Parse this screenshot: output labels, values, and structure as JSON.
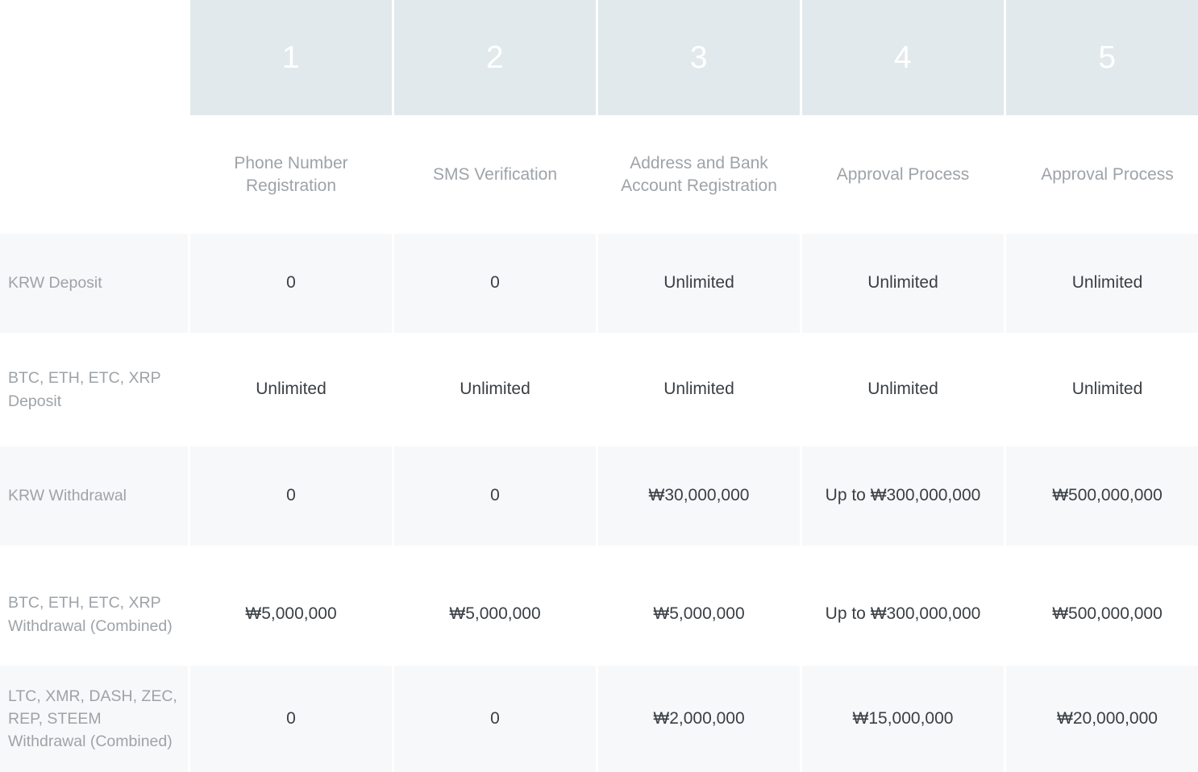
{
  "table": {
    "step_numbers": [
      "1",
      "2",
      "3",
      "4",
      "5"
    ],
    "step_names": [
      "Phone Number Registration",
      "SMS Verification",
      "Address and Bank Account Registration",
      "Approval Process",
      "Approval Process"
    ],
    "corner_label": "",
    "rows": [
      {
        "label": "KRW Deposit",
        "values": [
          "0",
          "0",
          "Unlimited",
          "Unlimited",
          "Unlimited"
        ]
      },
      {
        "label": "BTC, ETH, ETC, XRP Deposit",
        "values": [
          "Unlimited",
          "Unlimited",
          "Unlimited",
          "Unlimited",
          "Unlimited"
        ]
      },
      {
        "label": "KRW Withdrawal",
        "values": [
          "0",
          "0",
          "₩30,000,000",
          "Up to ₩300,000,000",
          "₩500,000,000"
        ]
      },
      {
        "label": "BTC, ETH, ETC, XRP Withdrawal (Combined)",
        "values": [
          "₩5,000,000",
          "₩5,000,000",
          "₩5,000,000",
          "Up to ₩300,000,000",
          "₩500,000,000"
        ]
      },
      {
        "label": "LTC, XMR, DASH, ZEC, REP, STEEM Withdrawal (Combined)",
        "values": [
          "0",
          "0",
          "₩2,000,000",
          "₩15,000,000",
          "₩20,000,000"
        ]
      }
    ]
  },
  "colors": {
    "header_bg": "#e2e9ec",
    "header_number": "#ffffff",
    "label_text": "#9ea3a8",
    "value_text": "#3a3f44",
    "row_shaded_bg": "#f7f8f9",
    "row_plain_bg": "#ffffff"
  }
}
